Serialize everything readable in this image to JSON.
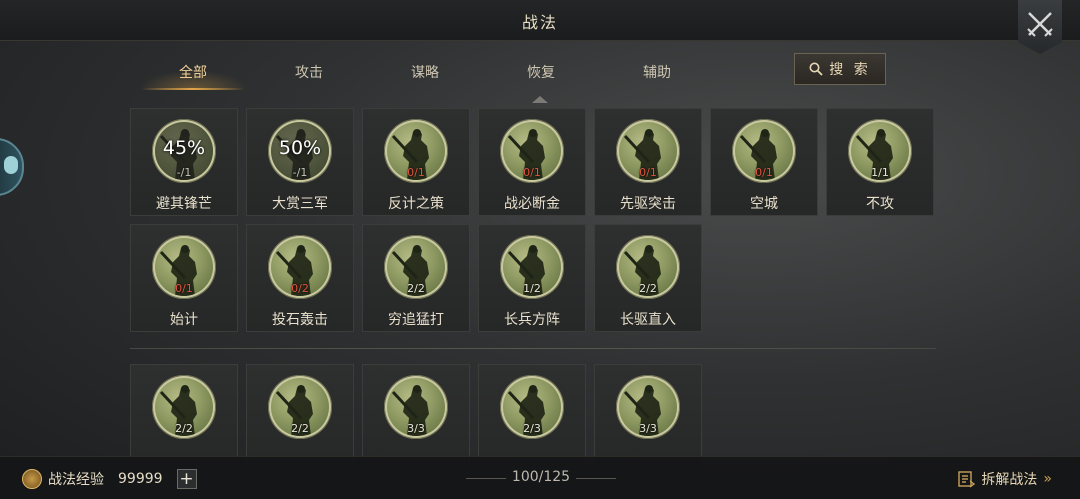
{
  "header": {
    "title": "战法"
  },
  "tabs": [
    {
      "label": "全部",
      "active": true
    },
    {
      "label": "攻击",
      "active": false
    },
    {
      "label": "谋略",
      "active": false
    },
    {
      "label": "恢复",
      "active": false
    },
    {
      "label": "辅助",
      "active": false
    }
  ],
  "search": {
    "label": "搜 索"
  },
  "tactics": [
    {
      "name": "避其锋芒",
      "count": "-/1",
      "progress": "45%",
      "state": "learning"
    },
    {
      "name": "大赏三军",
      "count": "-/1",
      "progress": "50%",
      "state": "learning"
    },
    {
      "name": "反计之策",
      "count": "0/1",
      "state": "zero"
    },
    {
      "name": "战必断金",
      "count": "0/1",
      "state": "zero"
    },
    {
      "name": "先驱突击",
      "count": "0/1",
      "state": "zero"
    },
    {
      "name": "空城",
      "count": "0/1",
      "state": "zero"
    },
    {
      "name": "不攻",
      "count": "1/1",
      "state": "normal"
    },
    {
      "name": "始计",
      "count": "0/1",
      "state": "zero"
    },
    {
      "name": "投石轰击",
      "count": "0/2",
      "state": "zero"
    },
    {
      "name": "穷追猛打",
      "count": "2/2",
      "state": "normal"
    },
    {
      "name": "长兵方阵",
      "count": "1/2",
      "state": "normal"
    },
    {
      "name": "长驱直入",
      "count": "2/2",
      "state": "normal"
    },
    {
      "name": "",
      "count": "2/2",
      "state": "normal"
    },
    {
      "name": "",
      "count": "2/2",
      "state": "normal"
    },
    {
      "name": "",
      "count": "3/3",
      "state": "normal"
    },
    {
      "name": "",
      "count": "2/3",
      "state": "normal"
    },
    {
      "name": "",
      "count": "3/3",
      "state": "normal"
    }
  ],
  "footer": {
    "xp_label": "战法经验",
    "xp_value": "99999",
    "plus": "+",
    "capacity": "100/125",
    "decompose_label": "拆解战法",
    "decompose_arrow": "»"
  },
  "colors": {
    "accent": "#e0a54a",
    "zero_count": "#e0523f"
  }
}
